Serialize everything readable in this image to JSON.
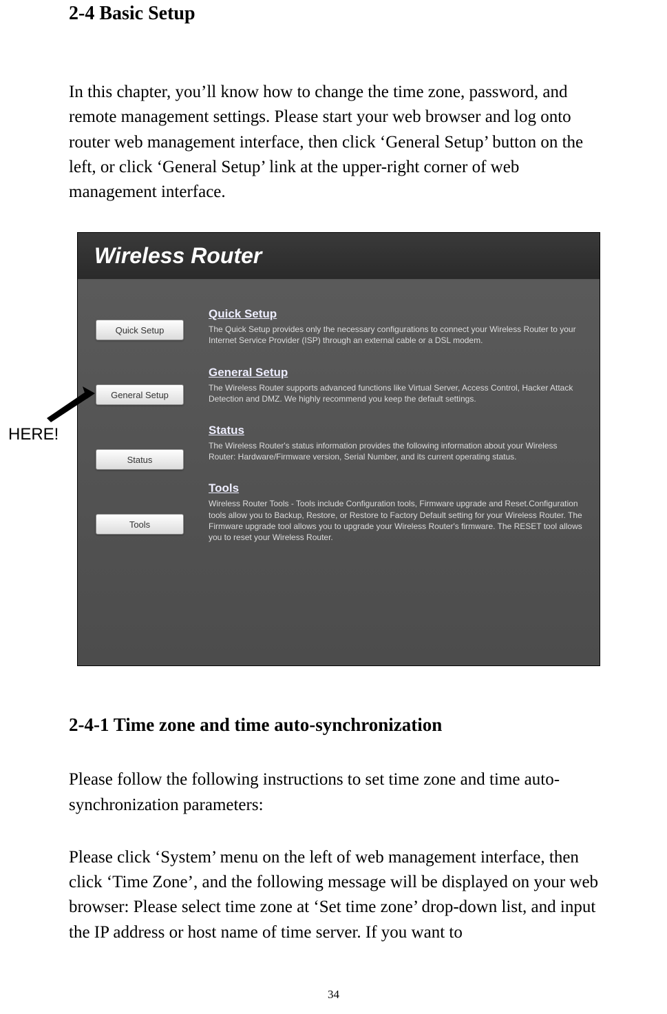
{
  "heading": "2-4 Basic Setup",
  "intro_para": "In this chapter, you’ll know how to change the time zone, password, and remote management settings. Please start your web browser and log onto router web management interface, then click ‘General Setup’ button on the left, or click ‘General Setup’ link at the upper-right corner of web management interface.",
  "screenshot": {
    "header_title": "Wireless Router",
    "sidebar": {
      "buttons": [
        {
          "label": "Quick Setup"
        },
        {
          "label": "General Setup"
        },
        {
          "label": "Status"
        },
        {
          "label": "Tools"
        }
      ]
    },
    "sections": [
      {
        "title": "Quick Setup",
        "desc": "The Quick Setup provides only the necessary configurations to connect your Wireless Router to your Internet Service Provider (ISP) through an external cable or a DSL modem."
      },
      {
        "title": "General Setup",
        "desc": "The Wireless Router supports advanced functions like Virtual Server, Access Control, Hacker Attack Detection and DMZ. We highly recommend you keep the default settings."
      },
      {
        "title": "Status",
        "desc": "The Wireless Router's status information provides the following information about your Wireless Router: Hardware/Firmware version, Serial Number, and its current operating status."
      },
      {
        "title": "Tools",
        "desc": "Wireless Router Tools - Tools include Configuration tools, Firmware upgrade and Reset.Configuration tools allow you to Backup, Restore, or Restore to Factory Default setting for your Wireless Router. The Firmware upgrade tool allows you to upgrade your Wireless Router's firmware. The RESET tool allows you to reset your Wireless Router."
      }
    ]
  },
  "annotation_text": "HERE!",
  "subheading": "2-4-1 Time zone and time auto-synchronization",
  "para2": "Please follow the following instructions to set time zone and time auto-synchronization parameters:",
  "para3": "Please click ‘System’ menu on the left of web management interface, then click ‘Time Zone’, and the following message will be displayed on your web browser: Please select time zone at ‘Set time zone’ drop-down list, and input the IP address or host name of time server. If you want to",
  "page_number": "34"
}
